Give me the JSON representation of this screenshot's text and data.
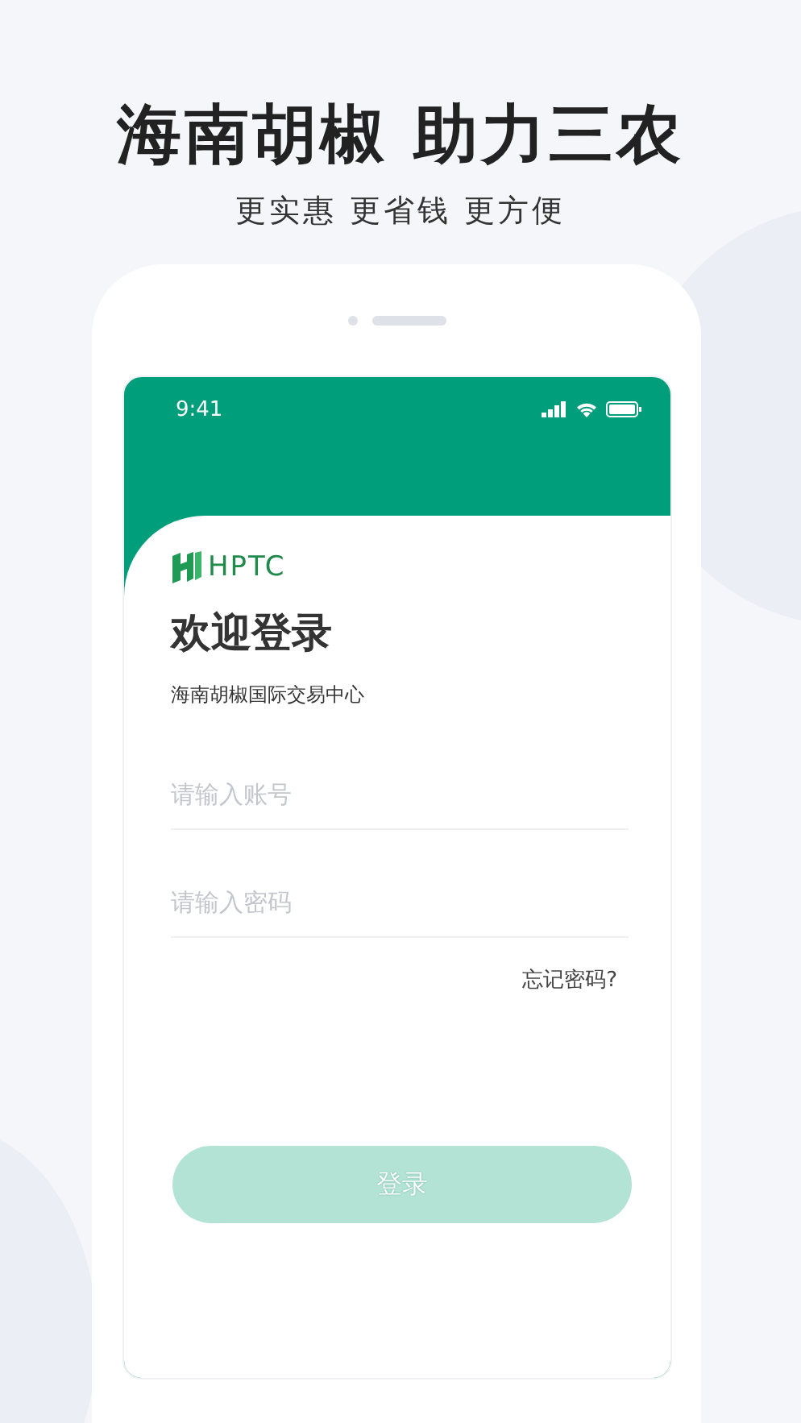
{
  "headline": "海南胡椒 助力三农",
  "subtitle": "更实惠 更省钱 更方便",
  "status_bar": {
    "time": "9:41"
  },
  "brand": {
    "logo_text": "HPTC"
  },
  "title": "欢迎登录",
  "organization": "海南胡椒国际交易中心",
  "fields": [
    {
      "placeholder": "请输入账号"
    },
    {
      "placeholder": "请输入密码"
    }
  ],
  "forgot_link": "忘记密码?",
  "login_button": {
    "label": "登录",
    "disabled": true
  }
}
